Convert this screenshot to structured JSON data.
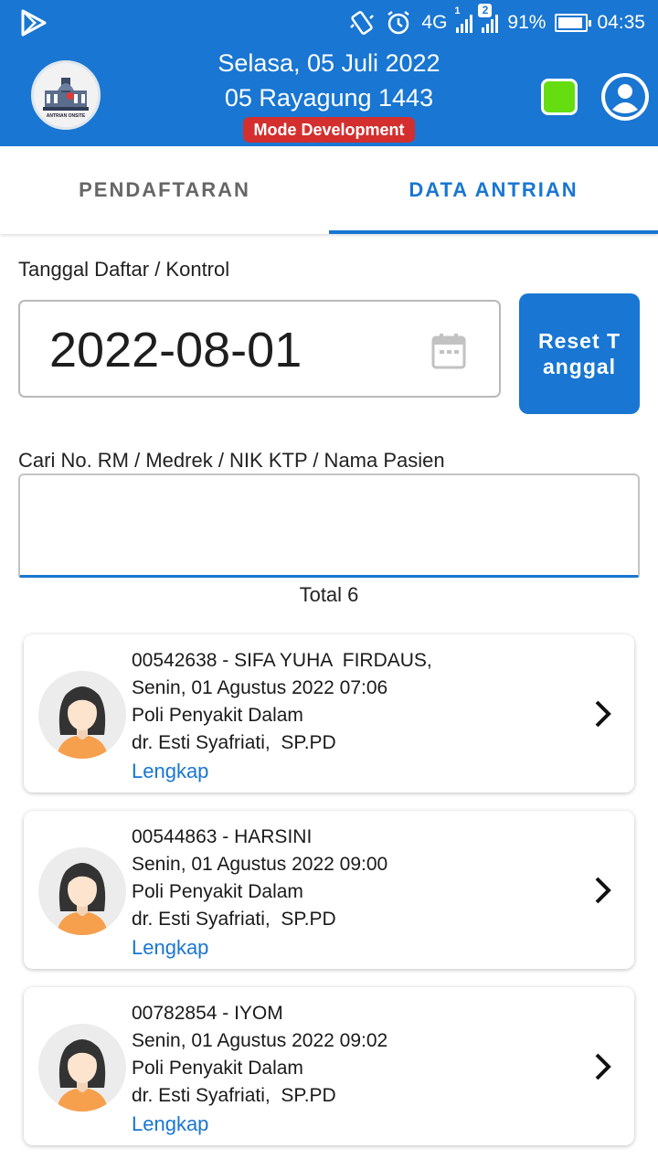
{
  "status_bar": {
    "network": "4G",
    "sim1_label": "1",
    "sim2_label": "2",
    "battery": "91%",
    "battery_level": 0.91,
    "time": "04:35"
  },
  "header": {
    "date_gregorian": "Selasa, 05 Juli 2022",
    "date_sunda": "05 Rayagung 1443",
    "mode_badge": "Mode Development",
    "logo_text": "ANTRIAN ONSITE",
    "indicator_color": "#66dd11",
    "brand_color": "#1976d2"
  },
  "tabs": [
    {
      "label": "PENDAFTARAN",
      "active": false
    },
    {
      "label": "DATA ANTRIAN",
      "active": true
    }
  ],
  "form": {
    "date_label": "Tanggal Daftar / Kontrol",
    "date_value": "2022-08-01",
    "reset_button": "Reset Tanggal",
    "search_label": "Cari No. RM / Medrek / NIK KTP / Nama Pasien",
    "search_value": "",
    "total": "Total 6"
  },
  "patients": [
    {
      "title": "00542638 - SIFA YUHA  FIRDAUS,",
      "datetime": "Senin, 01 Agustus 2022 07:06",
      "clinic": "Poli Penyakit Dalam",
      "doctor": "dr. Esti Syafriati,  SP.PD",
      "status": "Lengkap"
    },
    {
      "title": "00544863 - HARSINI",
      "datetime": "Senin, 01 Agustus 2022 09:00",
      "clinic": "Poli Penyakit Dalam",
      "doctor": "dr. Esti Syafriati,  SP.PD",
      "status": "Lengkap"
    },
    {
      "title": "00782854 - IYOM",
      "datetime": "Senin, 01 Agustus 2022 09:02",
      "clinic": "Poli Penyakit Dalam",
      "doctor": "dr. Esti Syafriati,  SP.PD",
      "status": "Lengkap"
    }
  ]
}
